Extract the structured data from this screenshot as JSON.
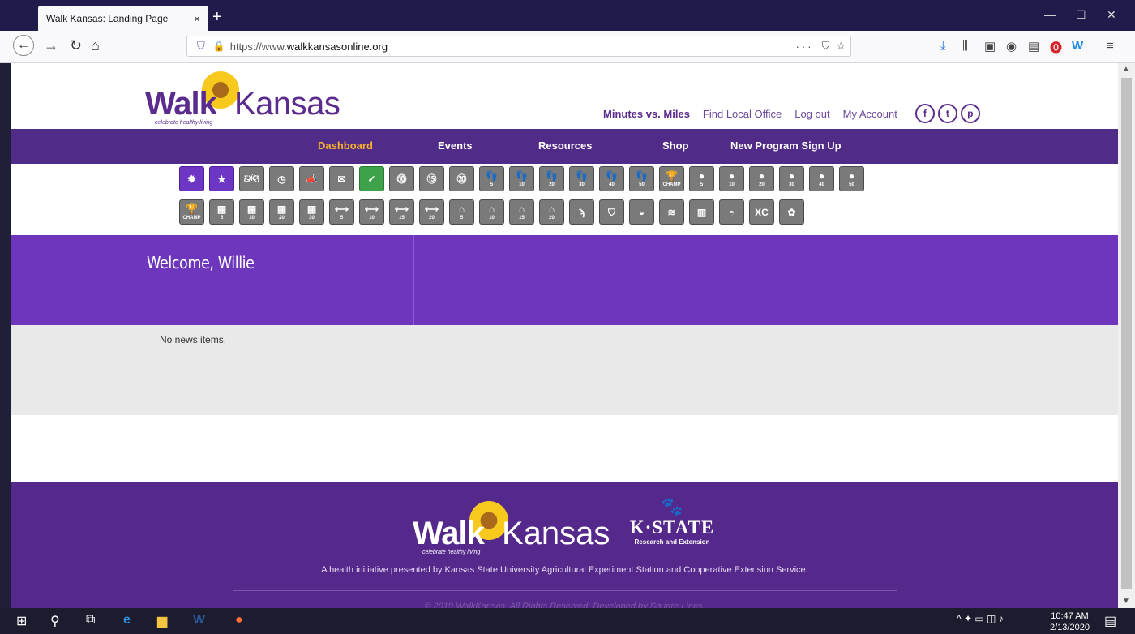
{
  "browser": {
    "tab_title": "Walk Kansas: Landing Page",
    "tab_close": "×",
    "new_tab": "+",
    "url_prefix": "https://www.",
    "url_domain": "walkkansasonline.org",
    "url_more": "···",
    "window_controls": [
      "—",
      "☐",
      "✕"
    ]
  },
  "site": {
    "logo_bold": "Walk",
    "logo_light": "Kansas",
    "logo_tagline": "celebrate healthy living",
    "top_links": {
      "minutes_vs_miles": "Minutes vs. Miles",
      "find_local_office": "Find Local Office",
      "log_out": "Log out",
      "my_account": "My Account"
    },
    "social": [
      "f",
      "t",
      "p"
    ],
    "nav": {
      "dashboard": "Dashboard",
      "events": "Events",
      "resources": "Resources",
      "shop": "Shop",
      "sign_up": "New Program Sign Up"
    },
    "badge_row1": [
      {
        "icon": "sunburst-icon",
        "glyph": "✹",
        "color": "purple"
      },
      {
        "icon": "star-icon",
        "glyph": "★",
        "color": "purple"
      },
      {
        "icon": "butterfly-icon",
        "glyph": "Ƹ̵̡Ӝ̵̨̄Ʒ"
      },
      {
        "icon": "clock-icon",
        "glyph": "◷"
      },
      {
        "icon": "megaphone-icon",
        "glyph": "📣"
      },
      {
        "icon": "mail-check-icon",
        "glyph": "✉"
      },
      {
        "icon": "check-circle-icon",
        "glyph": "✓",
        "color": "green"
      },
      {
        "icon": "medal-10-icon",
        "glyph": "⓾",
        "label": ""
      },
      {
        "icon": "medal-15-icon",
        "glyph": "⑮",
        "label": ""
      },
      {
        "icon": "medal-20-icon",
        "glyph": "⑳",
        "label": ""
      },
      {
        "icon": "footprints-5-icon",
        "glyph": "👣",
        "label": "5"
      },
      {
        "icon": "footprints-10-icon",
        "glyph": "👣",
        "label": "10"
      },
      {
        "icon": "footprints-20-icon",
        "glyph": "👣",
        "label": "20"
      },
      {
        "icon": "footprints-30-icon",
        "glyph": "👣",
        "label": "30"
      },
      {
        "icon": "footprints-40-icon",
        "glyph": "👣",
        "label": "40"
      },
      {
        "icon": "footprints-50-icon",
        "glyph": "👣",
        "label": "50"
      },
      {
        "icon": "trophy-champ-icon",
        "glyph": "🏆",
        "label": "CHAMP"
      },
      {
        "icon": "apple-5-icon",
        "glyph": "●",
        "label": "5"
      },
      {
        "icon": "apple-10-icon",
        "glyph": "●",
        "label": "10"
      },
      {
        "icon": "apple-20-icon",
        "glyph": "●",
        "label": "20"
      },
      {
        "icon": "apple-30-icon",
        "glyph": "●",
        "label": "30"
      },
      {
        "icon": "apple-40-icon",
        "glyph": "●",
        "label": "40"
      },
      {
        "icon": "apple-50-icon",
        "glyph": "●",
        "label": "50"
      }
    ],
    "badge_row2": [
      {
        "icon": "trophy-champ-icon",
        "glyph": "🏆",
        "label": "CHAMP"
      },
      {
        "icon": "building-5-icon",
        "glyph": "▦",
        "label": "5"
      },
      {
        "icon": "building-10-icon",
        "glyph": "▦",
        "label": "10"
      },
      {
        "icon": "building-20-icon",
        "glyph": "▦",
        "label": "20"
      },
      {
        "icon": "building-30-icon",
        "glyph": "▦",
        "label": "30"
      },
      {
        "icon": "arrows-5-icon",
        "glyph": "⟷",
        "label": "5"
      },
      {
        "icon": "arrows-10-icon",
        "glyph": "⟷",
        "label": "10"
      },
      {
        "icon": "arrows-15-icon",
        "glyph": "⟷",
        "label": "15"
      },
      {
        "icon": "arrows-20-icon",
        "glyph": "⟷",
        "label": "20"
      },
      {
        "icon": "map-5-icon",
        "glyph": "⌂",
        "label": "5"
      },
      {
        "icon": "map-10-icon",
        "glyph": "⌂",
        "label": "10"
      },
      {
        "icon": "map-15-icon",
        "glyph": "⌂",
        "label": "15"
      },
      {
        "icon": "map-20-icon",
        "glyph": "⌂",
        "label": "20"
      },
      {
        "icon": "wing-icon",
        "glyph": "ϡ"
      },
      {
        "icon": "hero-icon",
        "glyph": "⛉"
      },
      {
        "icon": "sunrise-icon",
        "glyph": "◒"
      },
      {
        "icon": "wind-icon",
        "glyph": "≋"
      },
      {
        "icon": "city-icon",
        "glyph": "▥"
      },
      {
        "icon": "sunset-icon",
        "glyph": "◓"
      },
      {
        "icon": "xc-icon",
        "glyph": "XC"
      },
      {
        "icon": "flower-icon",
        "glyph": "✿"
      }
    ],
    "welcome": "Welcome, Willie",
    "news_empty": "No news items.",
    "footer_logo_bold": "Walk",
    "footer_logo_light": "Kansas",
    "footer_tagline_small": "celebrate healthy living",
    "kstate_name": "K·STATE",
    "kstate_sub": "Research and Extension",
    "footer_tagline": "A health initiative presented by Kansas State University Agricultural Experiment Station and Cooperative Extension Service.",
    "copyright": "© 2019 WalkKansas. All Rights Reserved. Developed by Square Lines."
  },
  "taskbar": {
    "time": "10:47 AM",
    "date": "2/13/2020"
  },
  "colors": {
    "brand_purple": "#512b88",
    "welcome_purple": "#6d36bd",
    "active_nav": "#f8b12b",
    "badge_gray": "#7a7a7a"
  }
}
